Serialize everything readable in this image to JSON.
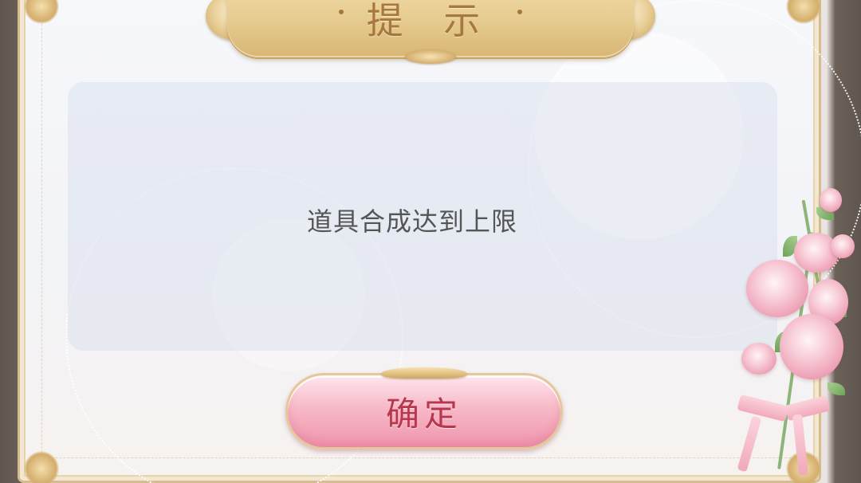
{
  "dialog": {
    "title": "提 示",
    "message": "道具合成达到上限",
    "confirm_label": "确定"
  },
  "icons": {
    "title_wings": "gold-wing-ornament",
    "corners": "gold-corner-ornament",
    "decoration": "pink-rose-bouquet"
  },
  "colors": {
    "title_text": "#a6783c",
    "banner_gold": "#e8cd91",
    "message_text": "#555555",
    "button_pink": "#f7b9c8",
    "button_text": "#b8374d"
  }
}
